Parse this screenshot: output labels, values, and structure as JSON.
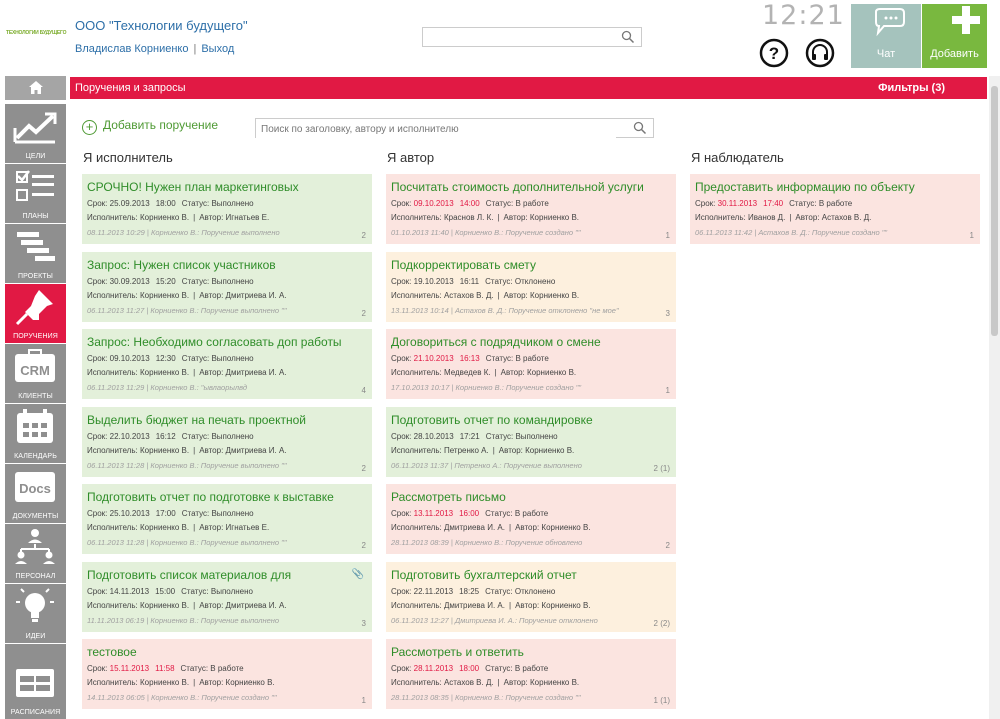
{
  "header": {
    "logo_text": "ТЕХНОЛОГИИ БУДУЩЕГО",
    "company": "ООО \"Технологии будущего\"",
    "user": "Владислав Корниенко",
    "separator": "|",
    "logout": "Выход",
    "time": "12:21",
    "chat_label": "Чат",
    "add_label": "Добавить"
  },
  "sidebar": {
    "items": [
      {
        "label": "Цели",
        "icon": "chart-trend-icon"
      },
      {
        "label": "Планы",
        "icon": "checklist-icon"
      },
      {
        "label": "Проекты",
        "icon": "gantt-icon"
      },
      {
        "label": "Поручения",
        "icon": "pushpin-icon",
        "active": true
      },
      {
        "label": "Клиенты",
        "icon": "crm-icon",
        "icon_text": "CRM"
      },
      {
        "label": "Календарь",
        "icon": "calendar-icon"
      },
      {
        "label": "Документы",
        "icon": "docs-icon",
        "icon_text": "Docs"
      },
      {
        "label": "Персонал",
        "icon": "org-chart-icon"
      },
      {
        "label": "Идеи",
        "icon": "lightbulb-icon"
      },
      {
        "label": "Расписания",
        "icon": "schedule-icon"
      }
    ]
  },
  "bar": {
    "title": "Поручения и запросы",
    "filters": "Фильтры (3)"
  },
  "toolbar": {
    "add_task": "Добавить поручение",
    "search_placeholder": "Поиск по заголовку, автору и исполнителю"
  },
  "labels": {
    "due": "Срок:",
    "status": "Статус:",
    "executor": "Исполнитель:",
    "author": "Автор:"
  },
  "columns": [
    {
      "title": "Я исполнитель",
      "cards": [
        {
          "color": "green",
          "title": "СРОЧНО! Нужен план маркетинговых",
          "date": "25.09.2013",
          "time": "18:00",
          "overdue": false,
          "status": "Выполнено",
          "executor": "Корниенко В.",
          "author": "Игнатьев Е.",
          "last": "08.11.2013  10:29 | Корниенко В.: Поручение выполнено",
          "count": "2"
        },
        {
          "color": "green",
          "title": "Запрос: Нужен список участников",
          "date": "30.09.2013",
          "time": "15:20",
          "overdue": false,
          "status": "Выполнено",
          "executor": "Корниенко В.",
          "author": "Дмитриева И. А.",
          "last": "06.11.2013  11:27 | Корниенко В.: Поручение выполнено \"\"",
          "count": "2"
        },
        {
          "color": "green",
          "title": "Запрос: Необходимо согласовать доп работы",
          "date": "09.10.2013",
          "time": "12:30",
          "overdue": false,
          "status": "Выполнено",
          "executor": "Корниенко В.",
          "author": "Дмитриева И. А.",
          "last": "06.11.2013  11:29 | Корниенко В.: \"ывлаорылвд",
          "count": "4"
        },
        {
          "color": "green",
          "title": "Выделить бюджет на печать проектной",
          "date": "22.10.2013",
          "time": "16:12",
          "overdue": false,
          "status": "Выполнено",
          "executor": "Корниенко В.",
          "author": "Дмитриева И. А.",
          "last": "06.11.2013  11:28 | Корниенко В.: Поручение выполнено \"\"",
          "count": "2"
        },
        {
          "color": "green",
          "title": "Подготовить отчет по подготовке к выставке",
          "date": "25.10.2013",
          "time": "17:00",
          "overdue": false,
          "status": "Выполнено",
          "executor": "Корниенко В.",
          "author": "Игнатьев Е.",
          "last": "06.11.2013  11:28 | Корниенко В.: Поручение выполнено \"\"",
          "count": "2"
        },
        {
          "color": "green",
          "title": "Подготовить список материалов для",
          "date": "14.11.2013",
          "time": "15:00",
          "overdue": false,
          "status": "Выполнено",
          "executor": "Корниенко В.",
          "author": "Дмитриева И. А.",
          "last": "11.11.2013  06:19 | Корниенко В.: Поручение выполнено",
          "count": "3",
          "clip": true
        },
        {
          "color": "pink",
          "title": "тестовое",
          "date": "15.11.2013",
          "time": "11:58",
          "overdue": true,
          "status": "В работе",
          "executor": "Корниенко В.",
          "author": "Корниенко В.",
          "last": "14.11.2013  06:05 | Корниенко В.: Поручение создано \"\"",
          "count": "1"
        }
      ]
    },
    {
      "title": "Я автор",
      "cards": [
        {
          "color": "pink",
          "title": "Посчитать стоимость дополнительной услуги",
          "date": "09.10.2013",
          "time": "14:00",
          "overdue": true,
          "status": "В работе",
          "executor": "Краснов Л. К.",
          "author": "Корниенко В.",
          "last": "01.10.2013  11:40 | Корниенко В.: Поручение создано \"\"",
          "count": "1"
        },
        {
          "color": "yellow",
          "title": "Подкорректировать смету",
          "date": "19.10.2013",
          "time": "16:11",
          "overdue": false,
          "status": "Отклонено",
          "executor": "Астахов В. Д.",
          "author": "Корниенко В.",
          "last": "13.11.2013  10:14 | Астахов В. Д.: Поручение отклонено \"не мое\"",
          "count": "3"
        },
        {
          "color": "pink",
          "title": "Договориться с подрядчиком о смене",
          "date": "21.10.2013",
          "time": "16:13",
          "overdue": true,
          "status": "В работе",
          "executor": "Медведев К.",
          "author": "Корниенко В.",
          "last": "17.10.2013  10:17 | Корниенко В.: Поручение создано \"\"",
          "count": "1"
        },
        {
          "color": "green",
          "title": "Подготовить отчет по командировке",
          "date": "28.10.2013",
          "time": "17:21",
          "overdue": false,
          "status": "Выполнено",
          "executor": "Петренко А.",
          "author": "Корниенко В.",
          "last": "06.11.2013  11:37 | Петренко А.: Поручение выполнено",
          "count": "2 (1)"
        },
        {
          "color": "pink",
          "title": "Рассмотреть письмо",
          "date": "13.11.2013",
          "time": "16:00",
          "overdue": true,
          "status": "В работе",
          "executor": "Дмитриева И. А.",
          "author": "Корниенко В.",
          "last": "28.11.2013  08:39 | Корниенко В.: Поручение обновлено",
          "count": "2"
        },
        {
          "color": "yellow",
          "title": "Подготовить бухгалтерский отчет",
          "date": "22.11.2013",
          "time": "18:25",
          "overdue": false,
          "status": "Отклонено",
          "executor": "Дмитриева И. А.",
          "author": "Корниенко В.",
          "last": "06.11.2013  12:27 | Дмитриева И. А.: Поручение отклонено",
          "count": "2 (2)"
        },
        {
          "color": "pink",
          "title": "Рассмотреть и ответить",
          "date": "28.11.2013",
          "time": "18:00",
          "overdue": true,
          "status": "В работе",
          "executor": "Астахов В. Д.",
          "author": "Корниенко В.",
          "last": "28.11.2013  08:35 | Корниенко В.: Поручение создано \"\"",
          "count": "1 (1)"
        }
      ]
    },
    {
      "title": "Я наблюдатель",
      "cards": [
        {
          "color": "pink",
          "title": "Предоставить информацию по объекту",
          "date": "30.11.2013",
          "time": "17:40",
          "overdue": true,
          "status": "В работе",
          "executor": "Иванов Д.",
          "author": "Астахов В. Д.",
          "last": "06.11.2013  11:42 | Астахов В. Д.: Поручение создано \"\"",
          "count": "1"
        }
      ]
    }
  ],
  "colors": {
    "accent": "#e11944",
    "green": "#79b83f",
    "chat": "#a5c3bd",
    "sidebar": "#8f8f8f",
    "link": "#2d6fa8",
    "title_green": "#2f8d29"
  }
}
